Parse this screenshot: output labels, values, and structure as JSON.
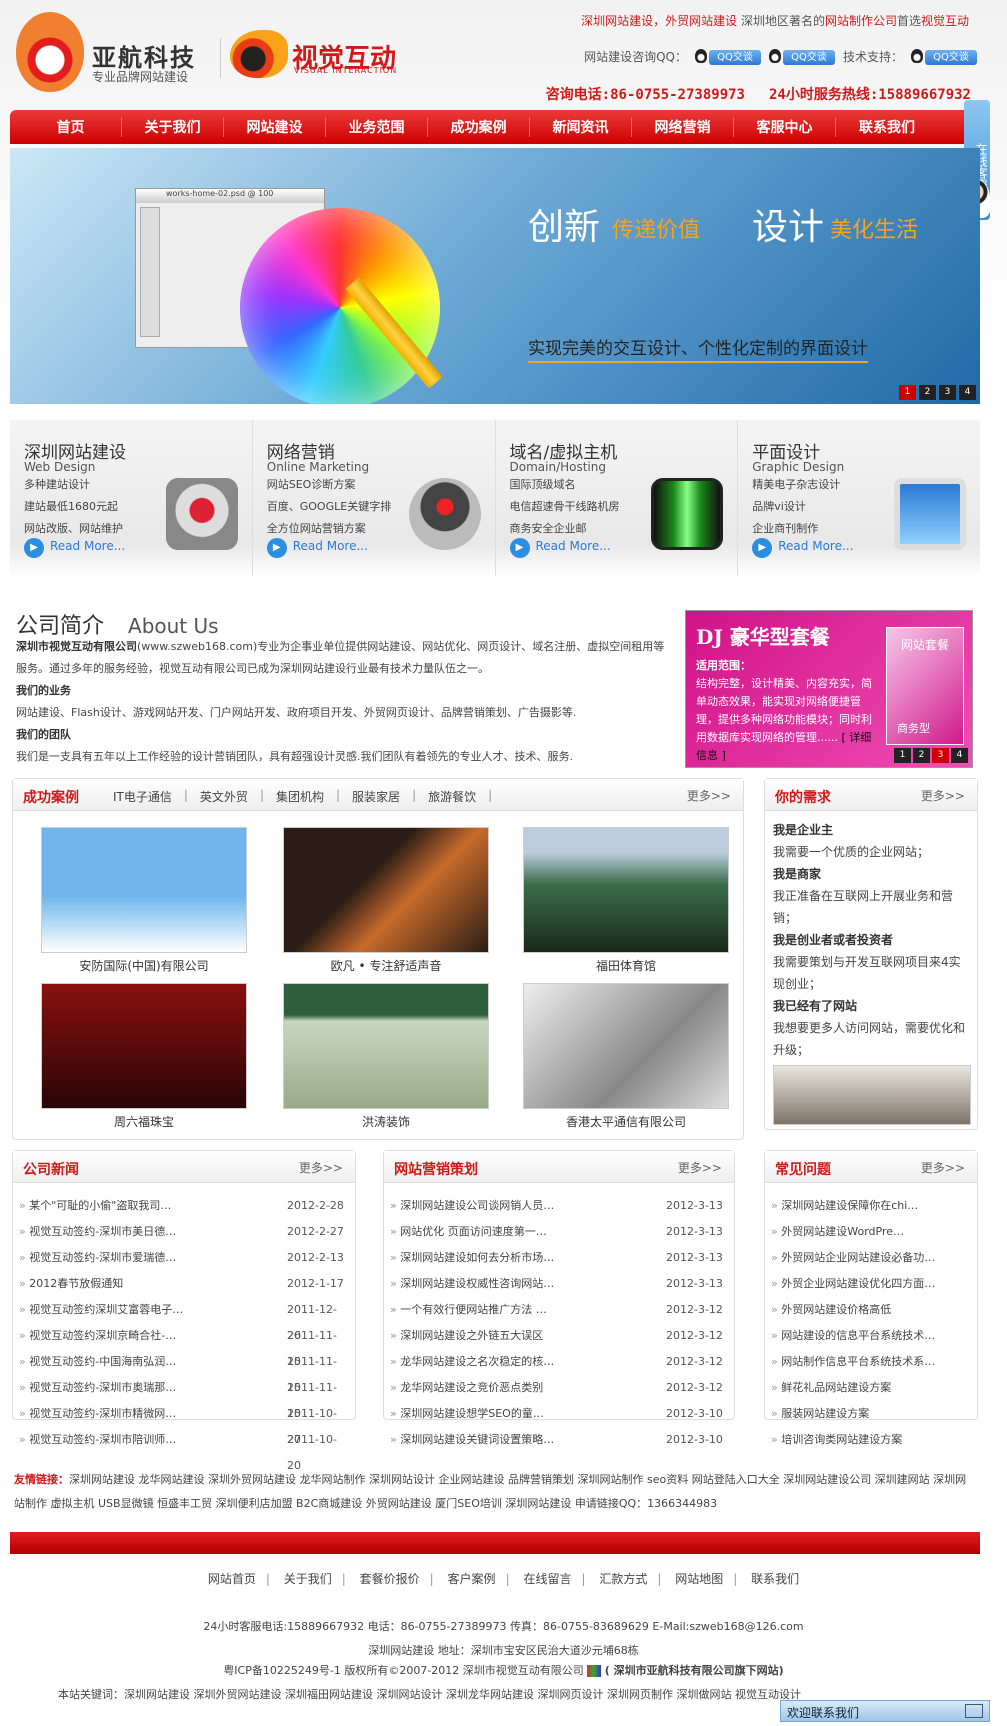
{
  "header": {
    "brand1": "亚航科技",
    "brand1_sub": "专业品牌网站建设",
    "brand2": "视觉互动",
    "brand2_sub": "VISUAL INTERACTION",
    "top_a": "深圳网站建设，外贸网站建设",
    "top_b": "深圳地区著名的",
    "top_c": "网站制作公司",
    "top_d": "首选",
    "top_e": "视觉互动",
    "qq_label": "网站建设咨询QQ：",
    "qq_btn": "QQ交谈",
    "tech_label": "技术支持：",
    "phone": "咨询电话:86-0755-27389973",
    "hotline": "24小时服务热线:15889667932"
  },
  "nav": [
    "首页",
    "关于我们",
    "网站建设",
    "业务范围",
    "成功案例",
    "新闻资讯",
    "网络营销",
    "客服中心",
    "联系我们"
  ],
  "side_float": "在线客服",
  "banner": {
    "file": "works-home-02.psd @ 100",
    "w1": "创新",
    "w2": "传递价值",
    "w3": "设计",
    "w4": "美化生活",
    "line": "实现完美的交互设计、个性化定制的界面设计",
    "dots": [
      "1",
      "2",
      "3",
      "4"
    ],
    "active_dot": 1
  },
  "services": [
    {
      "title": "深圳网站建设",
      "en": "Web Design",
      "l1": "多种建站设计",
      "l2": "建站最低1680元起",
      "l3": "网站改版、网站维护",
      "more": "Read More...",
      "color": "#d23"
    },
    {
      "title": "网络营销",
      "en": "Online Marketing",
      "l1": "网站SEO诊断方案",
      "l2": "百度、GOOGLE关键字排",
      "l3": "全方位网站营销方案",
      "more": "Read More...",
      "color": "#444"
    },
    {
      "title": "域名/虚拟主机",
      "en": "Domain/Hosting",
      "l1": "国际顶级域名",
      "l2": "电信超速骨干线路机房",
      "l3": "商务安全企业邮",
      "more": "Read More...",
      "color": "#1a8a1a"
    },
    {
      "title": "平面设计",
      "en": "Graphic Design",
      "l1": "精美电子杂志设计",
      "l2": "品牌vi设计",
      "l3": "企业商刊制作",
      "more": "Read More...",
      "color": "#2b79d4"
    }
  ],
  "about": {
    "title": "公司简介",
    "title_en": "About Us",
    "company": "深圳市视觉互动有限公司",
    "intro": "(www.szweb168.com)专业为企事业单位提供网站建设、网站优化、网页设计、域名注册、虚拟空间租用等服务。通过多年的服务经验，视觉互动有限公司已成为深圳网站建设行业最有技术力量队伍之一。",
    "biz_h": "我们的业务",
    "biz": "网站建设、Flash设计、游戏网站开发、门户网站开发、政府项目开发、外贸网页设计、品牌营销策划、广告摄影等.",
    "team_h": "我们的团队",
    "team": "我们是一支具有五年以上工作经验的设计营销团队，具有超强设计灵感.我们团队有着领先的专业人才、技术、服务."
  },
  "dj": {
    "title": "DJ 豪华型套餐",
    "label": "适用范围：",
    "text": "结构完整，设计精美、内容充实，简单动态效果，能实现对网络便捷管理，提供多种网络功能模块；同时利用数据库实现网络的管理......",
    "link": "[ 详细信息 ]",
    "box": "网站套餐",
    "box2": "商务型",
    "dots": [
      "1",
      "2",
      "3",
      "4"
    ]
  },
  "cases": {
    "title": "成功案例",
    "tabs": [
      "IT电子通信",
      "英文外贸",
      "集团机构",
      "服装家居",
      "旅游餐饮"
    ],
    "more": "更多>>",
    "items": [
      {
        "caption": "安防国际(中国)有限公司",
        "c1": "#6fb6ec",
        "c2": "#fff"
      },
      {
        "caption": "欧凡 • 专注舒适声音",
        "c1": "#2a1d16",
        "c2": "#c86a2a"
      },
      {
        "caption": "福田体育馆",
        "c1": "#3a6e4a",
        "c2": "#1a2a1a"
      },
      {
        "caption": "周六福珠宝",
        "c1": "#8a1010",
        "c2": "#2a0505"
      },
      {
        "caption": "洪涛装饰",
        "c1": "#2e5e3a",
        "c2": "#c8d8c0"
      },
      {
        "caption": "香港太平通信有限公司",
        "c1": "#ddd",
        "c2": "#555"
      }
    ]
  },
  "needs": {
    "title": "你的需求",
    "more": "更多>>",
    "rows": [
      {
        "h": "我是企业主",
        "t": "我需要一个优质的企业网站；"
      },
      {
        "h": "我是商家",
        "t": "我正准备在互联网上开展业务和营销；"
      },
      {
        "h": "我是创业者或者投资者",
        "t": "我需要策划与开发互联网项目来4实 现创业；"
      },
      {
        "h": "我已经有了网站",
        "t": "我想要更多人访问网站，需要优化和 升级；"
      }
    ]
  },
  "news": {
    "title": "公司新闻",
    "more": "更多>>",
    "items": [
      {
        "t": "某个\"可耻的小偷\"盗取我司…",
        "d": "2012-2-28"
      },
      {
        "t": "视觉互动签约-深圳市美日德…",
        "d": "2012-2-27"
      },
      {
        "t": "视觉互动签约-深圳市爱瑞德…",
        "d": "2012-2-13"
      },
      {
        "t": "2012春节放假通知",
        "d": "2012-1-17"
      },
      {
        "t": "视觉互动签约深圳艾富蓉电子…",
        "d": "2011-12-26"
      },
      {
        "t": "视觉互动签约深圳京畸合社-…",
        "d": "2011-11-15"
      },
      {
        "t": "视觉互动签约-中国海南弘润…",
        "d": "2011-11-15"
      },
      {
        "t": "视觉互动签约-深圳市奥瑞那…",
        "d": "2011-11-15"
      },
      {
        "t": "视觉互动签约-深圳市精微网…",
        "d": "2011-10-27"
      },
      {
        "t": "视觉互动签约-深圳市陪训师…",
        "d": "2011-10-20"
      }
    ]
  },
  "marketing": {
    "title": "网站营销策划",
    "more": "更多>>",
    "items": [
      {
        "t": "深圳网站建设公司谈网销人员…",
        "d": "2012-3-13"
      },
      {
        "t": "网站优化 页面访问速度第一…",
        "d": "2012-3-13"
      },
      {
        "t": "深圳网站建设如何去分析市场…",
        "d": "2012-3-13"
      },
      {
        "t": "深圳网站建设权威性咨询网站…",
        "d": "2012-3-13"
      },
      {
        "t": "一个有效行便网站推广方法 …",
        "d": "2012-3-12"
      },
      {
        "t": "深圳网站建设之外链五大误区",
        "d": "2012-3-12"
      },
      {
        "t": "龙华网站建设之名次稳定的核…",
        "d": "2012-3-12"
      },
      {
        "t": "龙华网站建设之竞价恶点类别",
        "d": "2012-3-12"
      },
      {
        "t": "深圳网站建设想学SEO的童…",
        "d": "2012-3-10"
      },
      {
        "t": "深圳网站建设关键词设置策略…",
        "d": "2012-3-10"
      }
    ]
  },
  "faq": {
    "title": "常见问题",
    "more": "更多>>",
    "items": [
      "深圳网站建设保障你在chi…",
      "外贸网站建设WordPre…",
      "外贸网站企业网站建设必备功…",
      "外贸企业网站建设优化四方面…",
      "外贸网站建设价格高低",
      "网站建设的信息平台系统技术…",
      "网站制作信息平台系统技术系…",
      "鲜花礼品网站建设方案",
      "服装网站建设方案",
      "培训咨询类网站建设方案"
    ]
  },
  "links": {
    "label": "友情链接：",
    "text": "深圳网站建设  龙华网站建设  深圳外贸网站建设  龙华网站制作  深圳网站设计  企业网站建设  品牌营销策划  深圳网站制作  seo资料  网站登陆入口大全  深圳网站建设公司  深圳建网站  深圳网站制作   虚拟主机  USB显微镜  恒盛丰工贸  深圳便利店加盟  B2C商城建设  外贸网站建设  厦门SEO培训  深圳网站建设   申请链接QQ：1366344983"
  },
  "footer": {
    "nav": [
      "网站首页",
      "关于我们",
      "套餐价报价",
      "客户案例",
      "在线留言",
      "汇款方式",
      "网站地图",
      "联系我们"
    ],
    "line1": "24小时客服电话:15889667932  电话：86-0755-27389973   传真：86-0755-83689629   E-Mail:szweb168@126.com",
    "line2": "深圳网站建设  地址：深圳市宝安区民治大道沙元埔68栋",
    "line3": "粤ICP备10225249号-1  版权所有©2007-2012  深圳市视觉互动有限公司",
    "line3b": "( 深圳市亚航科技有限公司旗下网站)",
    "line4": "本站关键词：深圳网站建设   深圳外贸网站建设   深圳福田网站建设   深圳网站设计   深圳龙华网站建设   深圳网页设计   深圳网页制作   深圳做网站  视觉互动设计",
    "chat": "欢迎联系我们"
  }
}
